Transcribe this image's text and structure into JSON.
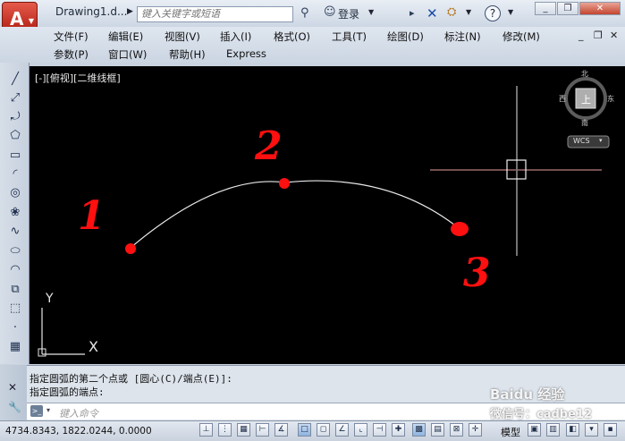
{
  "title_bar": {
    "document_title": "Drawing1.d...",
    "search_placeholder": "键入关键字或短语",
    "login_label": "登录",
    "help_label": "?"
  },
  "menu": {
    "row1": [
      "文件(F)",
      "编辑(E)",
      "视图(V)",
      "插入(I)",
      "格式(O)",
      "工具(T)",
      "绘图(D)",
      "标注(N)",
      "修改(M)"
    ],
    "row2": [
      "参数(P)",
      "窗口(W)",
      "帮助(H)",
      "Express"
    ]
  },
  "left_toolbar": {
    "icons": [
      "line-icon",
      "construction-line-icon",
      "polyline-icon",
      "polygon-icon",
      "rectangle-icon",
      "arc-icon",
      "circle-icon",
      "revision-cloud-icon",
      "spline-icon",
      "ellipse-icon",
      "ellipse-arc-icon",
      "insert-block-icon",
      "make-block-icon",
      "point-icon",
      "hatch-icon"
    ]
  },
  "canvas": {
    "view_label": "[-][俯视][二维线框]",
    "background": "#000000",
    "arc_color": "#ffffff",
    "marker_color": "#ff1010",
    "annotations": [
      "1",
      "2",
      "3"
    ],
    "crosshair_color": "#ffffff",
    "viewcube": {
      "north": "北",
      "south": "南",
      "east": "东",
      "west": "西",
      "face": "上",
      "wcs_label": "WCS"
    },
    "ucs": {
      "x": "X",
      "y": "Y"
    }
  },
  "command": {
    "line1": "指定圆弧的第二个点或 [圆心(C)/端点(E)]:",
    "line2": "指定圆弧的端点:",
    "input_placeholder": "键入命令"
  },
  "status": {
    "coordinates": "4734.8343, 1822.0244, 0.0000",
    "model_label": "模型"
  },
  "watermark": {
    "line1": "Baidu 经验",
    "line2": "微信号：cadbe12"
  }
}
